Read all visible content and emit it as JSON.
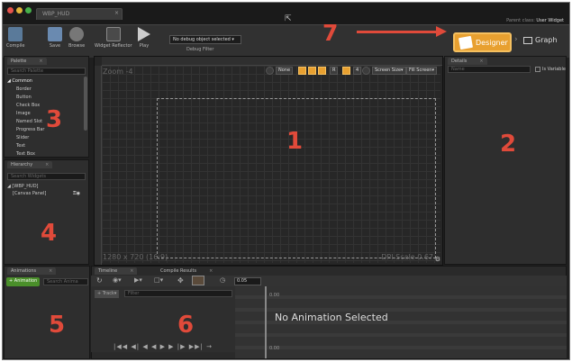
{
  "title_bar": {
    "doc_tab": "WBP_HUD",
    "parent_class_label": "Parent class:",
    "parent_class_value": "User Widget"
  },
  "toolbar": {
    "compile": "Compile",
    "save": "Save",
    "browse": "Browse",
    "widget_reflector": "Widget Reflector",
    "play": "Play",
    "debug_select": "No debug object selected ▾",
    "debug_filter": "Debug Filter",
    "designer": "Designer",
    "graph": "Graph"
  },
  "palette": {
    "tab": "Palette",
    "search_placeholder": "Search Palette",
    "group": "◢ Common",
    "items": [
      "Border",
      "Button",
      "Check Box",
      "Image",
      "Named Slot",
      "Progress Bar",
      "Slider",
      "Text",
      "Text Box"
    ]
  },
  "hierarchy": {
    "tab": "Hierarchy",
    "search_placeholder": "Search Widgets",
    "root": "◢ [WBP_HUD]",
    "child": "[Canvas Panel]"
  },
  "designer_canvas": {
    "zoom": "Zoom -4",
    "resolution": "1280 x 720 (16:9)",
    "dpi": "DPI Scale 0.67",
    "toolbar": {
      "none": "None",
      "grid_size": "4",
      "screen_size": "Screen Size▾",
      "fill_screen": "Fill Screen▾",
      "r_label": "R"
    }
  },
  "details": {
    "tab": "Details",
    "search_placeholder": "Name",
    "is_variable": "Is Variable"
  },
  "animations": {
    "tab": "Animations",
    "add_button": "+ Animation",
    "search_placeholder": "Search Anima"
  },
  "timeline": {
    "tab_timeline": "Timeline",
    "tab_compile_results": "Compile Results",
    "track_button": "+ Track▾",
    "filter_placeholder": "Filter",
    "camera_value": "0.05",
    "time_left": "0.00",
    "no_animation": "No Animation Selected",
    "transport": "|◀◀ ◀| ◀ ◀ ▶ ▶ |▶ ▶▶| →"
  },
  "callouts": [
    "1",
    "2",
    "3",
    "4",
    "5",
    "6",
    "7"
  ],
  "colors": {
    "accent": "#e8a030",
    "callout": "#e04a3a",
    "panel": "#2e2e2e"
  }
}
